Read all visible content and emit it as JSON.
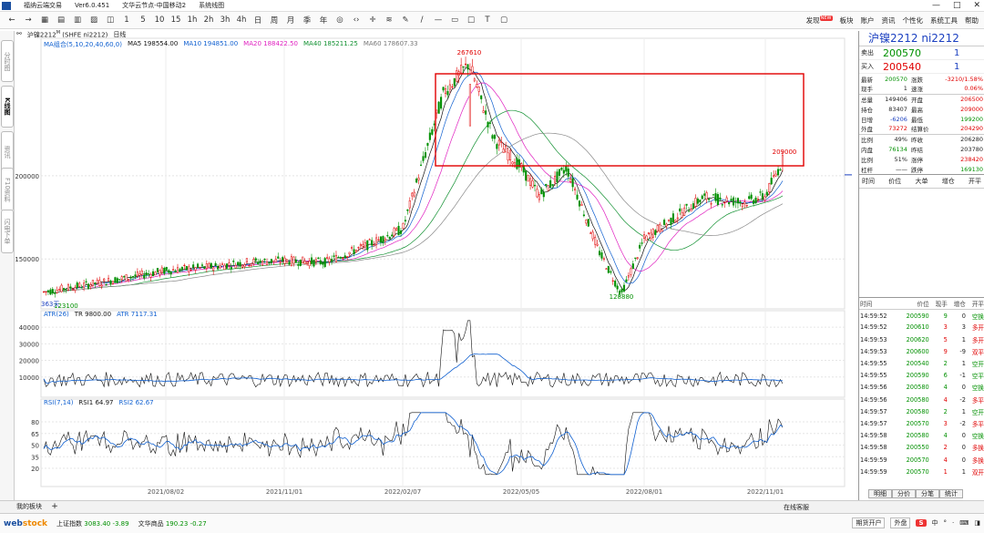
{
  "app": {
    "title": "福纳云端交易",
    "version": "Ver6.0.451",
    "server": "文华云节点-中国移动2",
    "menu_system": "系统线图"
  },
  "toolbar": {
    "icons": [
      "arrow-left-icon",
      "arrow-right-icon",
      "grid-icon",
      "list-icon",
      "table-icon",
      "chart-icon",
      "split-icon",
      "1",
      "5",
      "10",
      "15",
      "1h",
      "2h",
      "3h",
      "4h",
      "日",
      "周",
      "月",
      "季",
      "年",
      "eye-icon",
      "code-icon",
      "crosshair-icon",
      "measure-icon",
      "pen-icon",
      "line-icon",
      "hline-icon",
      "box-icon",
      "square-icon",
      "text-icon",
      "stop-icon"
    ],
    "labels": [
      "←",
      "→",
      "▦",
      "▤",
      "▥",
      "▨",
      "◫",
      "1",
      "5",
      "10",
      "15",
      "1h",
      "2h",
      "3h",
      "4h",
      "日",
      "周",
      "月",
      "季",
      "年",
      "◎",
      "‹›",
      "✛",
      "≋",
      "✎",
      "/",
      "—",
      "▭",
      "□",
      "T",
      "▢"
    ],
    "right_items": [
      "发现",
      "板块",
      "账户",
      "资讯",
      "个性化",
      "系统工具",
      "帮助"
    ],
    "new_badge": "NEW"
  },
  "left_tabs": [
    "分时图",
    "K线图",
    "资讯",
    "F10资料",
    "闪电下单"
  ],
  "chart": {
    "symbol_label": "沪镍2212",
    "symbol_sup": "M",
    "symbol_code": "(SHFE ni2212)",
    "period": "日线",
    "ma_header": {
      "name": "MA组合(5,10,20,40,60,0)",
      "ma5": "MA5 198554.00",
      "ma10": "MA10 194851.00",
      "ma20": "MA20 188422.50",
      "ma40": "MA40 185211.25",
      "ma60": "MA60 178607.33"
    },
    "atr_header": {
      "name": "ATR(26)",
      "tr": "TR 9800.00",
      "atr": "ATR 7117.31"
    },
    "rsi_header": {
      "name": "RSI(7,14)",
      "rsi1": "RSI1 64.97",
      "rsi2": "RSI2 62.67"
    },
    "price_axis": [
      "200000",
      "150000"
    ],
    "atr_axis": [
      "40000",
      "30000",
      "20000",
      "10000"
    ],
    "rsi_axis": [
      "80",
      "65",
      "50",
      "35",
      "20"
    ],
    "dates": [
      "2021/08/02",
      "2021/11/01",
      "2022/02/07",
      "2022/05/05",
      "2022/08/01",
      "2022/11/01"
    ],
    "annotations": {
      "high": "267610",
      "low": "128880",
      "recent_high": "209000",
      "start_low": "123100",
      "days": "363天"
    },
    "colors": {
      "up": "#e00000",
      "down": "#009000",
      "ma5": "#111111",
      "ma10": "#1060d0",
      "ma20": "#e020c0",
      "ma40": "#109030",
      "ma60": "#888888",
      "box": "#e00000"
    }
  },
  "chart_data": {
    "type": "line",
    "title": "沪镍2212 日线",
    "x_range": [
      "2021/06",
      "2022/11"
    ],
    "price_range": [
      120000,
      275000
    ],
    "price_keypoints": [
      {
        "date": "2021/06",
        "price": 130000
      },
      {
        "date": "2021/07",
        "price": 136000
      },
      {
        "date": "2021/08/02",
        "price": 143000
      },
      {
        "date": "2021/09",
        "price": 145000
      },
      {
        "date": "2021/10",
        "price": 148000
      },
      {
        "date": "2021/11/01",
        "price": 149000
      },
      {
        "date": "2021/12",
        "price": 148000
      },
      {
        "date": "2022/01",
        "price": 158000
      },
      {
        "date": "2022/02/07",
        "price": 168000
      },
      {
        "date": "2022/03",
        "price": 250000
      },
      {
        "date": "2022/03/08",
        "price": 267610
      },
      {
        "date": "2022/04",
        "price": 222000
      },
      {
        "date": "2022/05/05",
        "price": 205000
      },
      {
        "date": "2022/05/20",
        "price": 188000
      },
      {
        "date": "2022/06",
        "price": 205000
      },
      {
        "date": "2022/07",
        "price": 155000
      },
      {
        "date": "2022/07/15",
        "price": 128880
      },
      {
        "date": "2022/08/01",
        "price": 162000
      },
      {
        "date": "2022/09",
        "price": 187000
      },
      {
        "date": "2022/10",
        "price": 184000
      },
      {
        "date": "2022/11/01",
        "price": 188000
      },
      {
        "date": "2022/11/15",
        "price": 209000
      }
    ],
    "atr_range": [
      0,
      45000
    ],
    "rsi_range": [
      0,
      100
    ]
  },
  "quote": {
    "title": "沪镍2212 ni2212",
    "ask_label": "卖出",
    "ask_price": "200570",
    "ask_vol": "1",
    "bid_label": "买入",
    "bid_price": "200540",
    "bid_vol": "1",
    "rows": [
      [
        "最新",
        "200570",
        "涨跌",
        "-3210/1.58%"
      ],
      [
        "现手",
        "1",
        "速涨",
        "0.06%"
      ],
      [
        "总量",
        "149406",
        "开盘",
        "206500"
      ],
      [
        "持仓",
        "83407",
        "最高",
        "209000"
      ],
      [
        "日增",
        "-6206",
        "最低",
        "199200"
      ],
      [
        "外盘",
        "73272",
        "结算价",
        "204290"
      ],
      [
        "比例",
        "49%",
        "昨收",
        "206280"
      ],
      [
        "内盘",
        "76134",
        "昨结",
        "203780"
      ],
      [
        "比例",
        "51%",
        "涨停",
        "238420"
      ],
      [
        "杠杆",
        "——",
        "跌停",
        "169130"
      ]
    ],
    "sep_header": [
      "时间",
      "价位",
      "大单",
      "增仓",
      "开平"
    ]
  },
  "ticks": {
    "header": [
      "时间",
      "价位",
      "现手",
      "增仓",
      "开平"
    ],
    "rows": [
      [
        "14:59:52",
        "200590",
        "9",
        "0",
        "空换"
      ],
      [
        "14:59:52",
        "200610",
        "3",
        "3",
        "多开"
      ],
      [
        "14:59:53",
        "200620",
        "5",
        "1",
        "多开"
      ],
      [
        "14:59:53",
        "200600",
        "9",
        "-9",
        "双平"
      ],
      [
        "14:59:55",
        "200540",
        "2",
        "1",
        "空开"
      ],
      [
        "14:59:55",
        "200590",
        "6",
        "-1",
        "空平"
      ],
      [
        "14:59:56",
        "200580",
        "4",
        "0",
        "空换"
      ],
      [
        "14:59:56",
        "200580",
        "4",
        "-2",
        "多平"
      ],
      [
        "14:59:57",
        "200580",
        "2",
        "1",
        "空开"
      ],
      [
        "14:59:57",
        "200570",
        "3",
        "-2",
        "多平"
      ],
      [
        "14:59:58",
        "200580",
        "4",
        "0",
        "空换"
      ],
      [
        "14:59:58",
        "200550",
        "2",
        "0",
        "多换"
      ],
      [
        "14:59:59",
        "200570",
        "4",
        "0",
        "多换"
      ],
      [
        "14:59:59",
        "200570",
        "1",
        "1",
        "双开"
      ]
    ]
  },
  "right_tabs": [
    "明细",
    "分价",
    "分笔",
    "统计"
  ],
  "bottom": {
    "tab": "我的板块",
    "plus": "+"
  },
  "status": {
    "brand_a": "web",
    "brand_b": "stock",
    "idx1_name": "上证指数",
    "idx1_val": "3083.40",
    "idx1_chg": "-3.89",
    "idx2_name": "文华商品",
    "idx2_val": "190.23",
    "idx2_chg": "-0.27",
    "right": [
      "期货开户",
      "外盘",
      "S",
      "中",
      "°",
      "·",
      "⌨",
      "◨"
    ],
    "chat": "在线客服"
  }
}
